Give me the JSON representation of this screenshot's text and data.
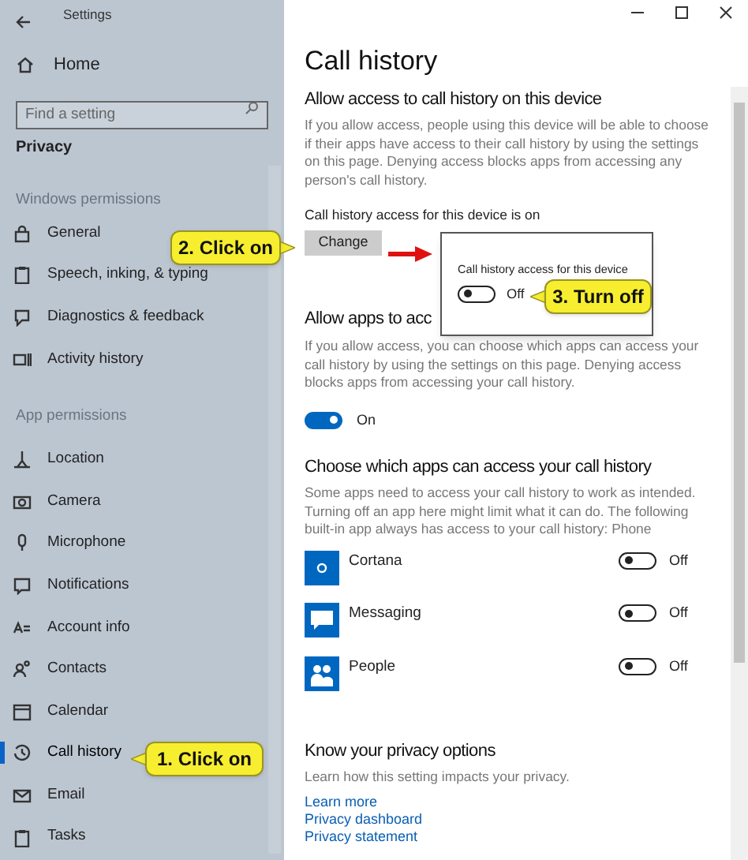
{
  "window": {
    "title": "Settings"
  },
  "sidebar": {
    "home": "Home",
    "search": {
      "placeholder": "Find a setting"
    },
    "section_title": "Privacy",
    "groups": [
      {
        "title": "Windows permissions",
        "items": [
          {
            "label": "General",
            "selected": false
          },
          {
            "label": "Speech, inking, & typing",
            "selected": false
          },
          {
            "label": "Diagnostics & feedback",
            "selected": false
          },
          {
            "label": "Activity history",
            "selected": false
          }
        ]
      },
      {
        "title": "App permissions",
        "items": [
          {
            "label": "Location",
            "selected": false
          },
          {
            "label": "Camera",
            "selected": false
          },
          {
            "label": "Microphone",
            "selected": false
          },
          {
            "label": "Notifications",
            "selected": false
          },
          {
            "label": "Account info",
            "selected": false
          },
          {
            "label": "Contacts",
            "selected": false
          },
          {
            "label": "Calendar",
            "selected": false
          },
          {
            "label": "Call history",
            "selected": true
          },
          {
            "label": "Email",
            "selected": false
          },
          {
            "label": "Tasks",
            "selected": false
          }
        ]
      }
    ]
  },
  "page": {
    "title": "Call history",
    "device_access": {
      "heading": "Allow access to call history on this device",
      "description": "If you allow access, people using this device will be able to choose if their apps have access to their call history by using the settings on this page. Denying access blocks apps from accessing any person's call history.",
      "status": "Call history access for this device is on",
      "button": "Change"
    },
    "popup": {
      "label": "Call history access for this device",
      "toggle": {
        "on": false,
        "text": "Off"
      }
    },
    "app_access": {
      "heading": "Allow apps to acc",
      "description": "If you allow access, you can choose which apps can access your call history by using the settings on this page. Denying access blocks apps from accessing your call history.",
      "toggle": {
        "on": true,
        "text": "On"
      }
    },
    "choose_apps": {
      "heading": "Choose which apps can access your call history",
      "description": "Some apps need to access your call history to work as intended. Turning off an app here might limit what it can do. The following built-in app always has access to your call history: Phone",
      "apps": [
        {
          "name": "Cortana",
          "on": false,
          "text": "Off"
        },
        {
          "name": "Messaging",
          "on": false,
          "text": "Off"
        },
        {
          "name": "People",
          "on": false,
          "text": "Off"
        }
      ]
    },
    "privacy_options": {
      "heading": "Know your privacy options",
      "description": "Learn how this setting impacts your privacy.",
      "links": [
        "Learn more",
        "Privacy dashboard",
        "Privacy statement"
      ]
    }
  },
  "callouts": [
    {
      "text": "1. Click on"
    },
    {
      "text": "2. Click on"
    },
    {
      "text": "3. Turn off"
    }
  ]
}
